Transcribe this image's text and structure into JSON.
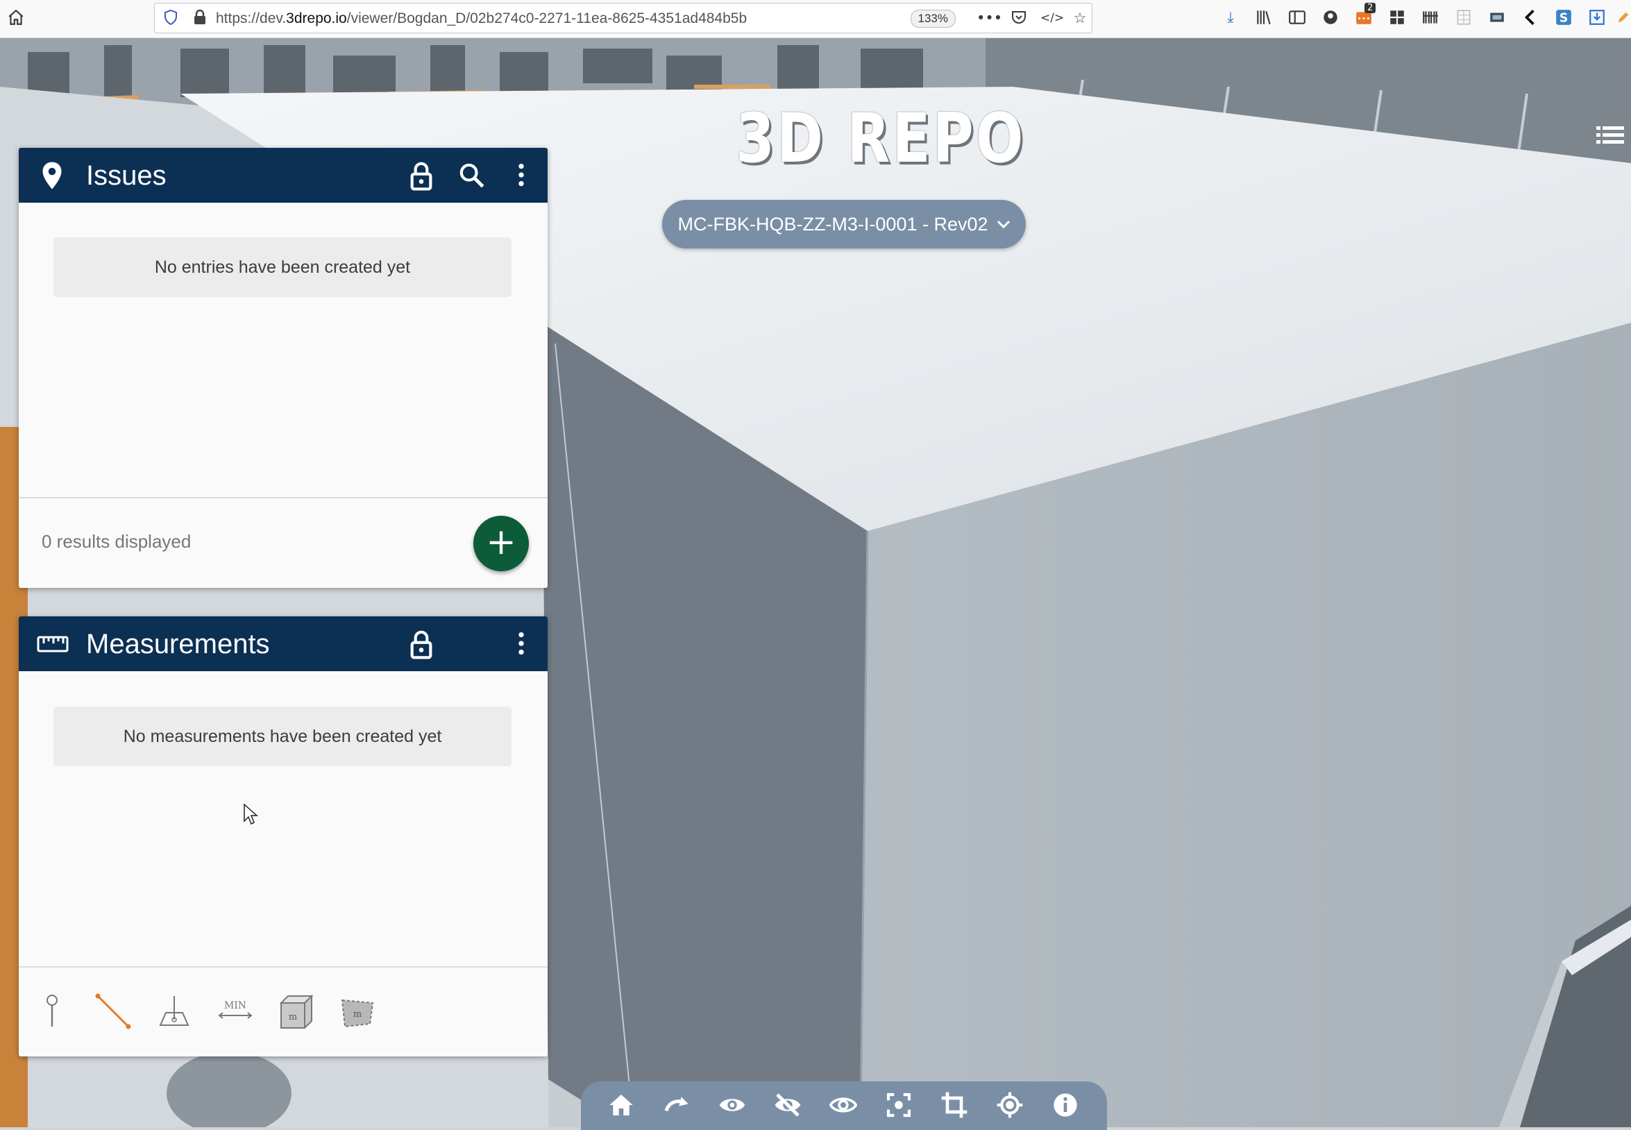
{
  "browser": {
    "url_prefix": "https://dev.",
    "url_domain": "3drepo.io",
    "url_path": "/viewer/Bogdan_D/02b274c0-2271-11ea-8625-4351ad484b5b",
    "zoom": "133%",
    "notification_count": "2"
  },
  "viewer": {
    "logo_text": "3D REPO",
    "revision_label": "MC-FBK-HQB-ZZ-M3-I-0001 - Rev02"
  },
  "issues_panel": {
    "title": "Issues",
    "empty_message": "No entries have been created yet",
    "results_text": "0 results displayed",
    "add_label": "+"
  },
  "measurements_panel": {
    "title": "Measurements",
    "empty_message": "No measurements have been created yet",
    "tools": [
      "point-tool",
      "length-tool",
      "perpendicular-tool",
      "min-distance-tool",
      "surface-area-tool",
      "polygon-area-tool"
    ],
    "min_label": "MIN",
    "unit_label": "m"
  },
  "bottom_toolbar": {
    "icons": [
      "home-icon",
      "turntable-icon",
      "show-all-icon",
      "hide-icon",
      "isolate-icon",
      "focus-icon",
      "clip-icon",
      "locate-icon",
      "info-icon"
    ]
  },
  "colors": {
    "panel_header": "#0c2f54",
    "fab": "#0c5c3a",
    "pill": "#7a8fa6"
  }
}
